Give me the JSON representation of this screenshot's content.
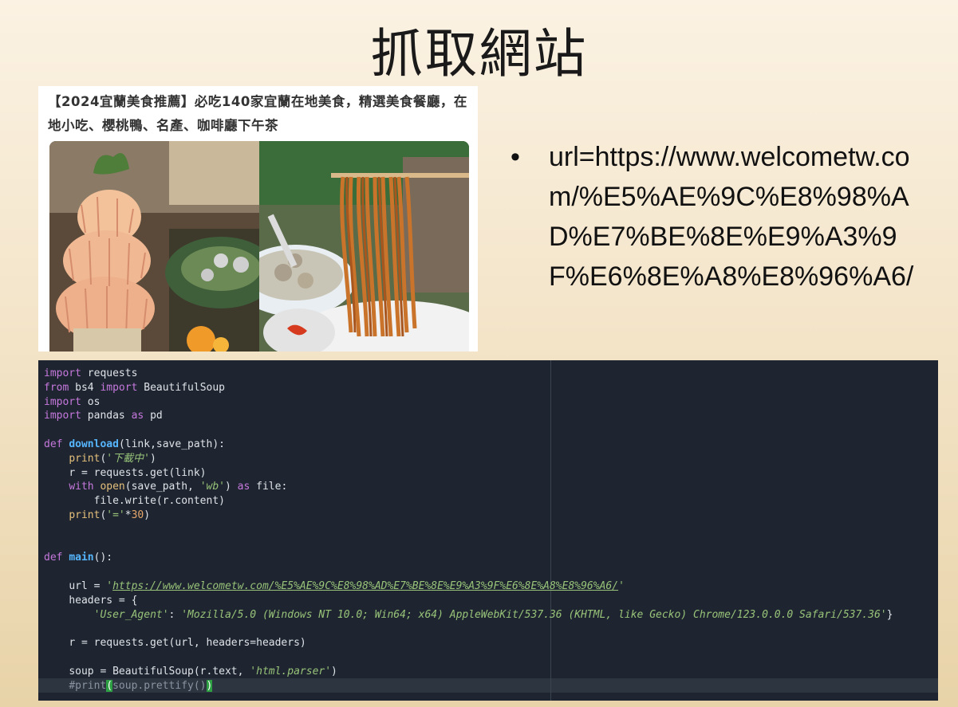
{
  "slide": {
    "title": "抓取網站"
  },
  "article": {
    "headline": "【2024宜蘭美食推薦】必吃140家宜蘭在地美食，精選美食餐廳，在地小吃、櫻桃鴨、名產、咖啡廳下午茶",
    "photos": [
      "peach-tower-dessert-photo",
      "noodles-and-meatball-soup-photo"
    ]
  },
  "bullet": {
    "text": "url=https://www.welcometw.com/%E5%AE%9C%E8%98%AD%E7%BE%8E%E9%A3%9F%E6%8E%A8%E8%96%A6/"
  },
  "code": {
    "l1": {
      "kw": "import",
      "rest": " requests"
    },
    "l2": {
      "kw1": "from",
      "mod": " bs4 ",
      "kw2": "import",
      "rest": " BeautifulSoup"
    },
    "l3": {
      "kw": "import",
      "rest": " os"
    },
    "l4": {
      "kw1": "import",
      "mod": " pandas ",
      "kw2": "as",
      "rest": " pd"
    },
    "l6": {
      "kw": "def",
      "name": "download",
      "params": "(link,save_path):"
    },
    "l7": {
      "fn": "print",
      "open": "(",
      "str": "'下載中'",
      "close": ")"
    },
    "l8": "r = requests.get(link)",
    "l9": {
      "kw": "with",
      "fn": "open",
      "args": "(save_path, ",
      "str": "'wb'",
      "close": ") ",
      "kw2": "as",
      "rest": " file:"
    },
    "l10": "file.write(r.content)",
    "l11": {
      "fn": "print",
      "open": "(",
      "str": "'='",
      "op": "*",
      "num": "30",
      "close": ")"
    },
    "l14": {
      "kw": "def",
      "name": "main",
      "params": "():"
    },
    "l16": {
      "lhs": "url = ",
      "q1": "'",
      "url": "https://www.welcometw.com/%E5%AE%9C%E8%98%AD%E7%BE%8E%E9%A3%9F%E6%8E%A8%E8%96%A6/",
      "q2": "'"
    },
    "l17": "headers = {",
    "l18": {
      "key": "'User_Agent'",
      "colon": ": ",
      "val": "'Mozilla/5.0 (Windows NT 10.0; Win64; x64) AppleWebKit/537.36 (KHTML, like Gecko) Chrome/123.0.0.0 Safari/537.36'",
      "close": "}"
    },
    "l20": "r = requests.get(url, headers=headers)",
    "l22": {
      "lhs": "soup = BeautifulSoup(r.text, ",
      "str": "'html.parser'",
      "close": ")"
    },
    "l23": {
      "a": "#print",
      "b": "(",
      "c": "soup.prettify()",
      "d": ")"
    }
  }
}
